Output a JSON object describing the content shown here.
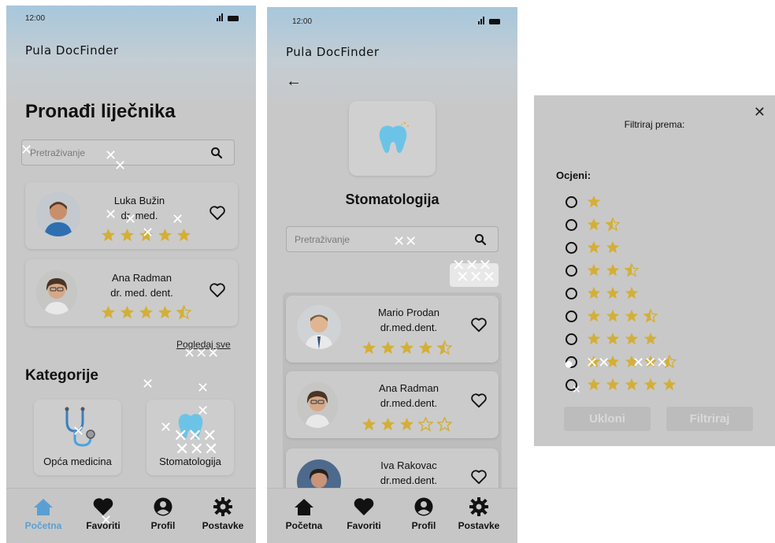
{
  "colors": {
    "accent": "#5a9fd4",
    "star": "#d4af37",
    "background": "#c8c8c8"
  },
  "status": {
    "time_1": "12:00",
    "time_2": "12:00"
  },
  "home": {
    "app_title": "Pula DocFinder",
    "heading": "Pronađi liječnika",
    "search_placeholder": "Pretraživanje",
    "doctors": [
      {
        "name": "Luka Bužin",
        "title": "dr. med.",
        "rating": 5
      },
      {
        "name": "Ana Radman",
        "title": "dr. med. dent.",
        "rating": 4.5
      }
    ],
    "see_all": "Pogledaj sve",
    "categories_heading": "Kategorije",
    "categories": [
      {
        "label": "Opća medicina",
        "icon": "stethoscope-icon"
      },
      {
        "label": "Stomatologija",
        "icon": "tooth-icon"
      }
    ]
  },
  "category": {
    "app_title": "Pula DocFinder",
    "title": "Stomatologija",
    "search_placeholder": "Pretraživanje",
    "doctors": [
      {
        "name": "Mario Prodan",
        "title": "dr.med.dent.",
        "rating": 4.5
      },
      {
        "name": "Ana Radman",
        "title": "dr.med.dent.",
        "rating": 3
      },
      {
        "name": "Iva Rakovac",
        "title": "dr.med.dent.",
        "rating": null
      }
    ]
  },
  "nav": {
    "items": [
      {
        "label": "Početna",
        "icon": "home-icon"
      },
      {
        "label": "Favoriti",
        "icon": "heart-icon"
      },
      {
        "label": "Profil",
        "icon": "profile-icon"
      },
      {
        "label": "Postavke",
        "icon": "settings-icon"
      }
    ]
  },
  "filter": {
    "title": "Filtriraj prema:",
    "rating_label": "Ocjeni:",
    "options": [
      1,
      1.5,
      2,
      2.5,
      3,
      3.5,
      4,
      4.5,
      5
    ],
    "remove_button": "Ukloni",
    "apply_button": "Filtriraj"
  }
}
